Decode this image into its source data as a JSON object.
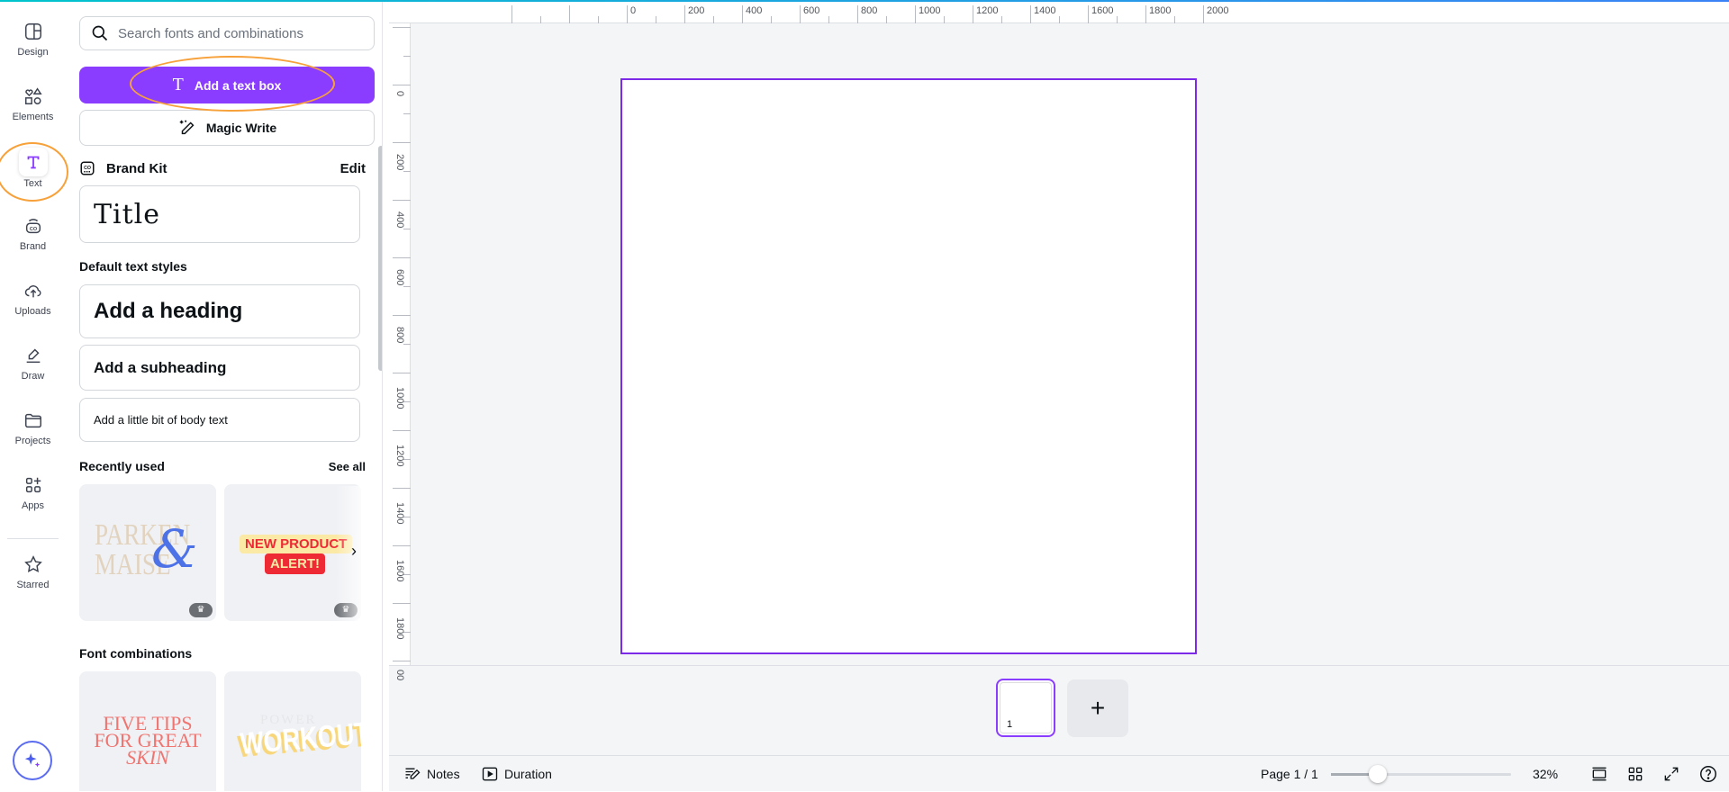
{
  "rail": {
    "items": [
      {
        "label": "Design",
        "icon": "layout-icon"
      },
      {
        "label": "Elements",
        "icon": "shapes-icon"
      },
      {
        "label": "Text",
        "icon": "text-icon",
        "active": true
      },
      {
        "label": "Brand",
        "icon": "brand-icon"
      },
      {
        "label": "Uploads",
        "icon": "cloud-upload-icon"
      },
      {
        "label": "Draw",
        "icon": "pen-icon"
      },
      {
        "label": "Projects",
        "icon": "folder-icon"
      },
      {
        "label": "Apps",
        "icon": "apps-icon"
      },
      {
        "label": "Starred",
        "icon": "star-icon"
      }
    ]
  },
  "panel": {
    "search_placeholder": "Search fonts and combinations",
    "add_text_box": "Add a text box",
    "magic_write": "Magic Write",
    "brand_kit": "Brand Kit",
    "edit": "Edit",
    "brand_title": "Title",
    "default_styles": "Default text styles",
    "heading": "Add a heading",
    "subheading": "Add a subheading",
    "body": "Add a little bit of body text",
    "recently_used": "Recently used",
    "see_all": "See all",
    "recent": [
      {
        "lines": [
          "PARKEN",
          "MAISE"
        ],
        "accent": "&"
      },
      {
        "lines": [
          "NEW PRODUCT",
          "ALERT!"
        ]
      }
    ],
    "font_combinations": "Font combinations",
    "combos": [
      {
        "lines": [
          "FIVE TIPS",
          "FOR GREAT",
          "SKIN"
        ]
      },
      {
        "lines": [
          "POWER",
          "WORKOUT"
        ]
      }
    ]
  },
  "rulers": {
    "horizontal": [
      "0",
      "200",
      "400",
      "600",
      "800",
      "1000",
      "1200",
      "1400",
      "1600",
      "1800",
      "2000"
    ],
    "vertical": [
      "0",
      "200",
      "400",
      "600",
      "800",
      "1000",
      "1200",
      "1400",
      "1600",
      "1800",
      "00"
    ]
  },
  "pages": {
    "thumb_number": "1"
  },
  "bottom": {
    "notes": "Notes",
    "duration": "Duration",
    "page_indicator": "Page 1 / 1",
    "zoom": "32%",
    "zoom_percent": 32
  },
  "colors": {
    "accent": "#8b3dff",
    "page_border": "#7d2ae8",
    "highlight": "#f7a13a"
  }
}
